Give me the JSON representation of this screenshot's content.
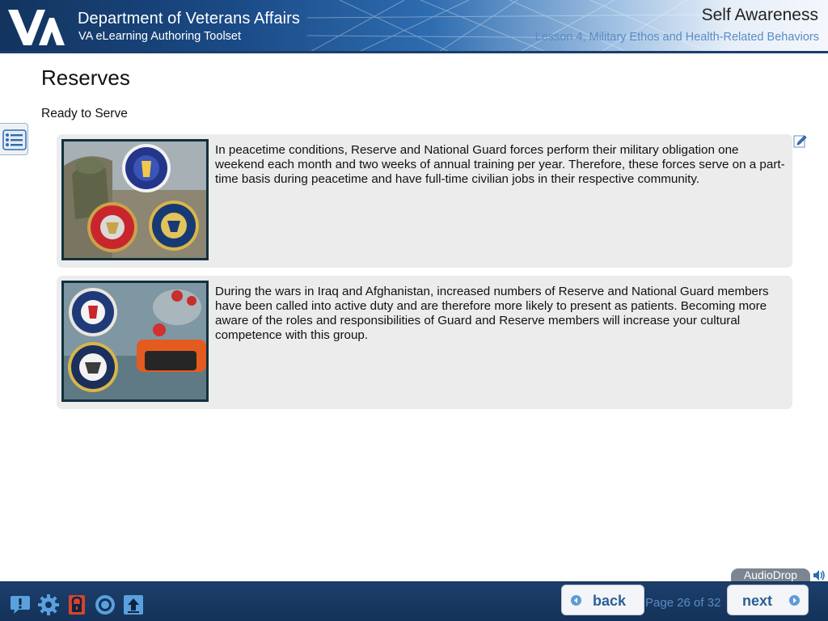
{
  "header": {
    "org_title": "Department of Veterans Affairs",
    "org_subtitle": "VA eLearning Authoring Toolset",
    "course_title": "Self Awareness",
    "lesson_title": "Lesson 4, Military Ethos and Health-Related Behaviors"
  },
  "content": {
    "title": "Reserves",
    "subheading": "Ready to Serve",
    "cards": [
      {
        "text": "In peacetime conditions, Reserve and National Guard forces perform their military obligation one weekend each month and two weeks of annual training per year. Therefore, these forces serve on a part-time basis during peacetime and have full-time civilian jobs in their respective community."
      },
      {
        "text": "During the wars in Iraq and Afghanistan, increased numbers of Reserve and National Guard members have been called into active duty and are therefore more likely to present as patients. Becoming more aware of the roles and responsibilities of Guard and Reserve members will increase your cultural competence with this group."
      }
    ]
  },
  "footer": {
    "audio_label": "AudioDrop",
    "back_label": "back",
    "next_label": "next",
    "page_counter": "Page 26 of 32",
    "tools": [
      "help-icon",
      "settings-gear-icon",
      "lock-icon",
      "target-icon",
      "upload-icon"
    ]
  },
  "colors": {
    "header_dark": "#12345e",
    "footer_bg": "#1d3f6c",
    "accent_blue": "#5a8cc4",
    "card_bg": "#ececec",
    "button_text": "#2b5f96"
  }
}
